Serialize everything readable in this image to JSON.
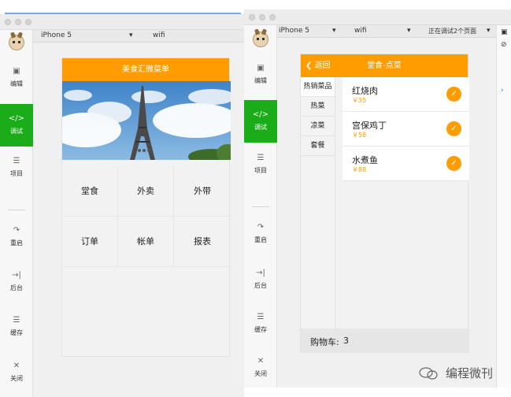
{
  "left_window": {
    "device": "iPhone 5",
    "network": "wifi",
    "sidebar": [
      {
        "icon": "code-box-icon",
        "label": "编辑"
      },
      {
        "icon": "debug-code-icon",
        "label": "调试"
      },
      {
        "icon": "menu-lines-icon",
        "label": "项目"
      },
      {
        "icon": "restart-icon",
        "label": "重启"
      },
      {
        "icon": "background-icon",
        "label": "后台"
      },
      {
        "icon": "cache-layers-icon",
        "label": "缓存"
      },
      {
        "icon": "close-icon",
        "label": "关闭"
      }
    ],
    "page_title": "美食汇微菜单",
    "grid": [
      "堂食",
      "外卖",
      "外带",
      "订单",
      "帐单",
      "报表"
    ]
  },
  "right_window": {
    "device": "iPhone 5",
    "network": "wifi",
    "debug_status": "正在调试2个页面",
    "sidebar": [
      {
        "icon": "code-box-icon",
        "label": "编辑"
      },
      {
        "icon": "debug-code-icon",
        "label": "调试"
      },
      {
        "icon": "menu-lines-icon",
        "label": "项目"
      },
      {
        "icon": "restart-icon",
        "label": "重启"
      },
      {
        "icon": "background-icon",
        "label": "后台"
      },
      {
        "icon": "cache-layers-icon",
        "label": "缓存"
      },
      {
        "icon": "close-icon",
        "label": "关闭"
      }
    ],
    "back_label": "返回",
    "page_title": "堂食-点菜",
    "categories": [
      "热销菜品",
      "热菜",
      "凉菜",
      "套餐"
    ],
    "dishes": [
      {
        "name": "红烧肉",
        "price": "￥35"
      },
      {
        "name": "宫保鸡丁",
        "price": "￥58"
      },
      {
        "name": "水煮鱼",
        "price": "￥88"
      }
    ],
    "cart_label": "购物车:",
    "cart_count": "3"
  },
  "watermark": "编程微刊",
  "colors": {
    "accent_orange": "#ff9d00",
    "active_green": "#1aad19"
  }
}
